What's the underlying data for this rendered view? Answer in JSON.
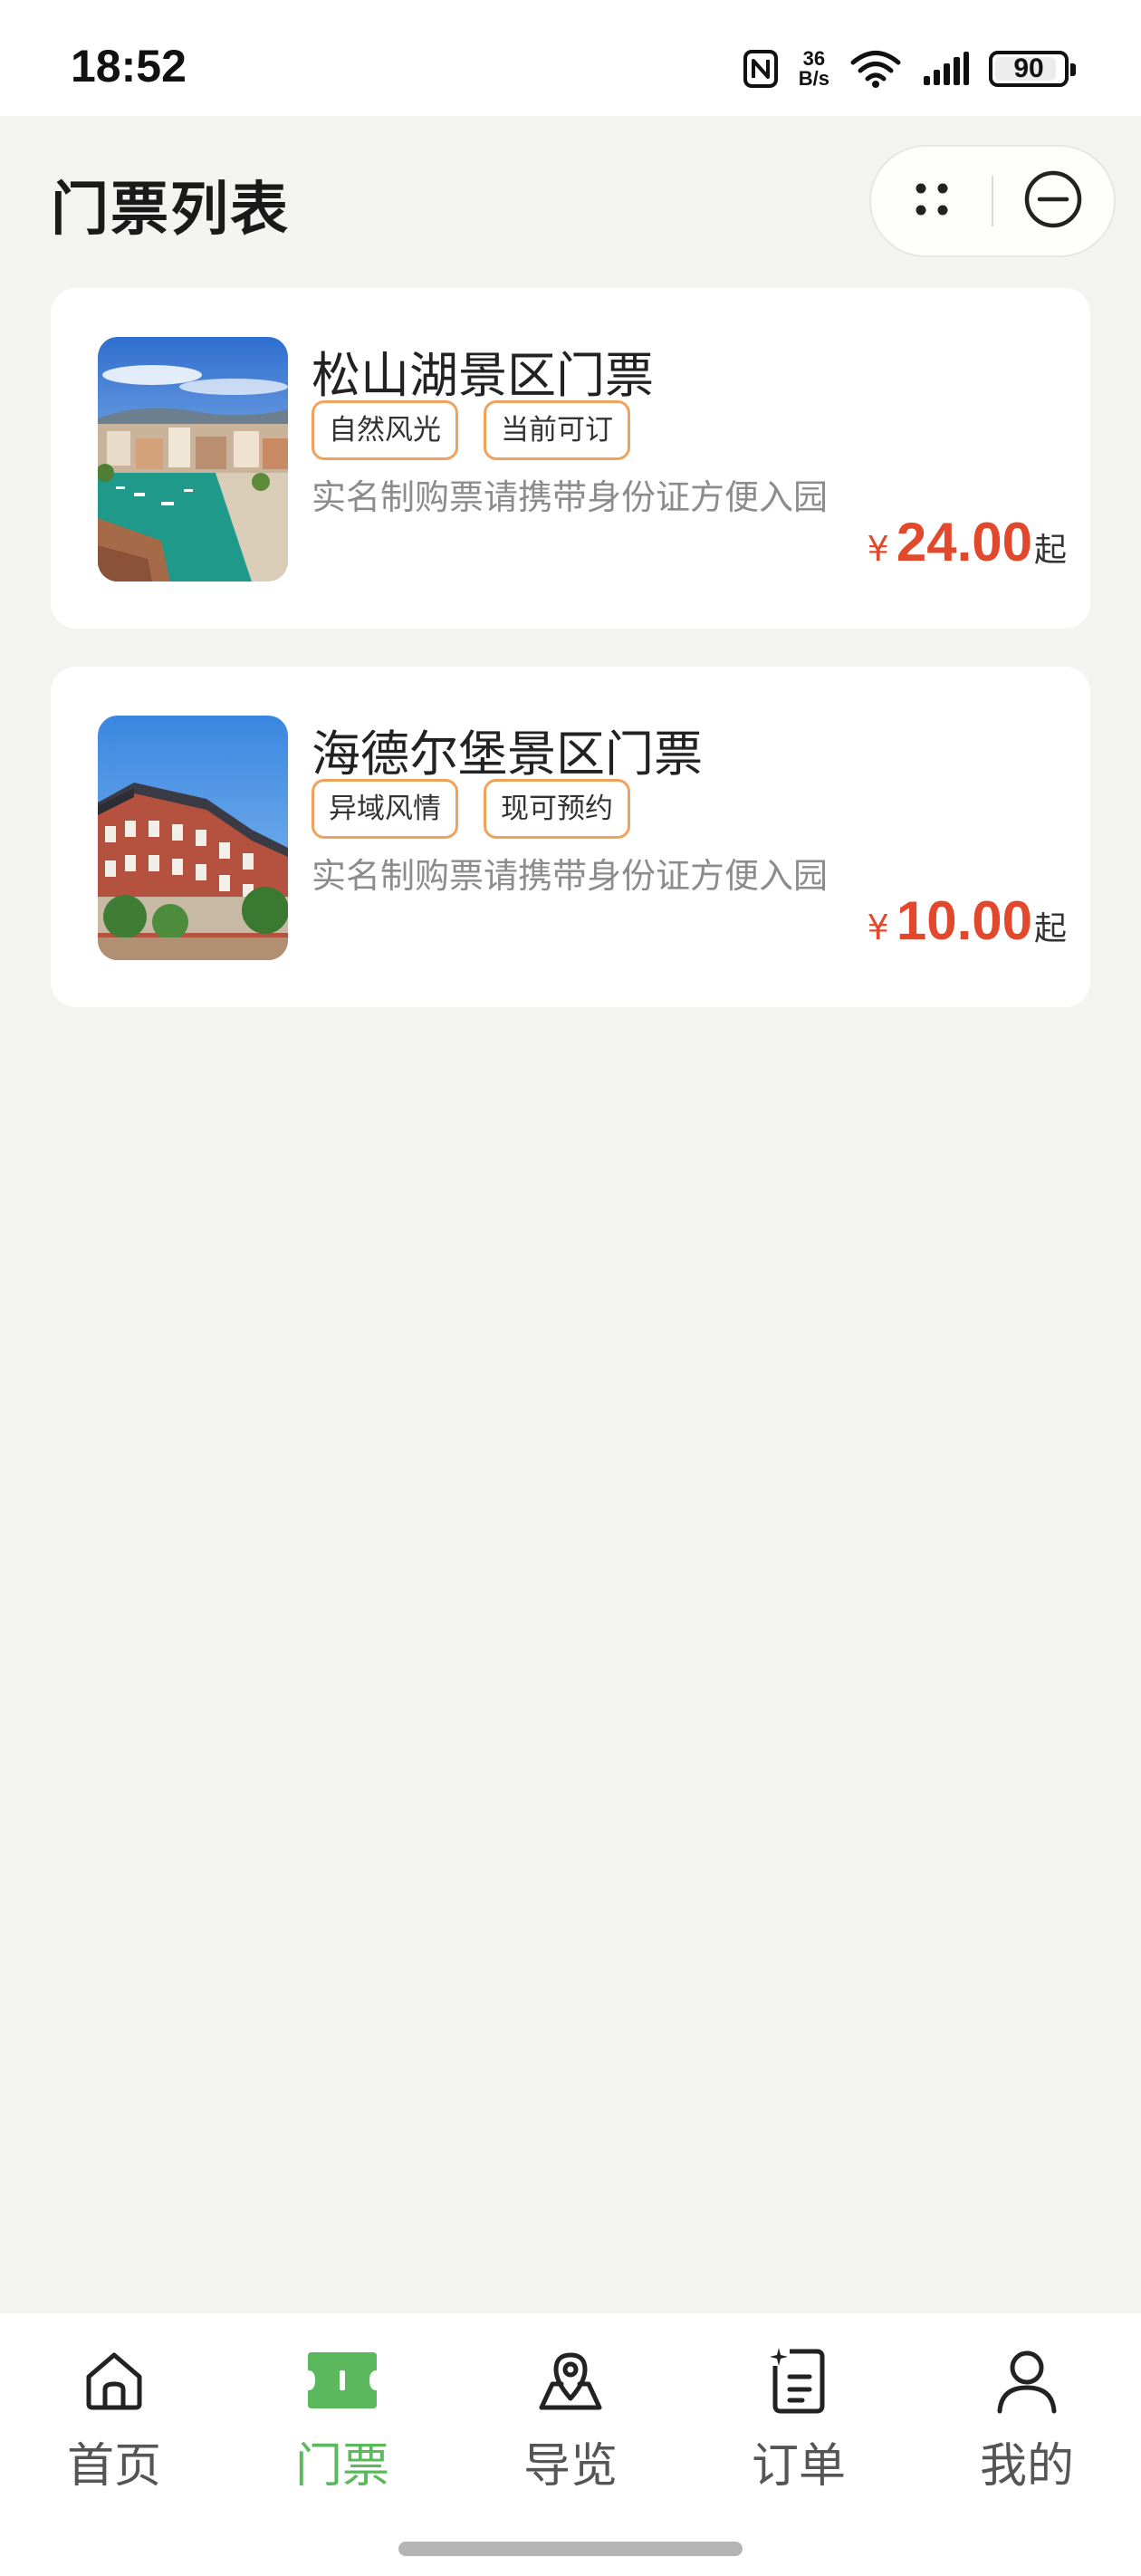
{
  "status_bar": {
    "time": "18:52",
    "net_speed_value": "36",
    "net_speed_unit": "B/s",
    "battery": "90",
    "battery_level": 0.9,
    "icons": [
      "nfc-icon",
      "wifi-icon",
      "signal-icon",
      "battery-icon"
    ]
  },
  "page": {
    "title": "门票列表"
  },
  "capsule": {
    "icons": [
      "more-dots-icon",
      "minimize-icon"
    ]
  },
  "tickets": [
    {
      "name": "松山湖景区门票",
      "tags": [
        "自然风光",
        "当前可订"
      ],
      "note": "实名制购票请携带身份证方便入园",
      "currency": "¥",
      "price": "24.00",
      "price_suffix": "起",
      "image": "lakeside-town-photo"
    },
    {
      "name": "海德尔堡景区门票",
      "tags": [
        "异域风情",
        "现可预约"
      ],
      "note": "实名制购票请携带身份证方便入园",
      "currency": "¥",
      "price": "10.00",
      "price_suffix": "起",
      "image": "european-castle-photo"
    }
  ],
  "tabbar": {
    "active_index": 1,
    "active_color": "#5bb85c",
    "items": [
      {
        "label": "首页",
        "icon": "home-icon"
      },
      {
        "label": "门票",
        "icon": "ticket-icon"
      },
      {
        "label": "导览",
        "icon": "map-pin-icon"
      },
      {
        "label": "订单",
        "icon": "order-icon"
      },
      {
        "label": "我的",
        "icon": "user-icon"
      }
    ]
  },
  "colors": {
    "price": "#e2492c",
    "tag_border": "#f0a25c",
    "background": "#f3f4f2"
  }
}
